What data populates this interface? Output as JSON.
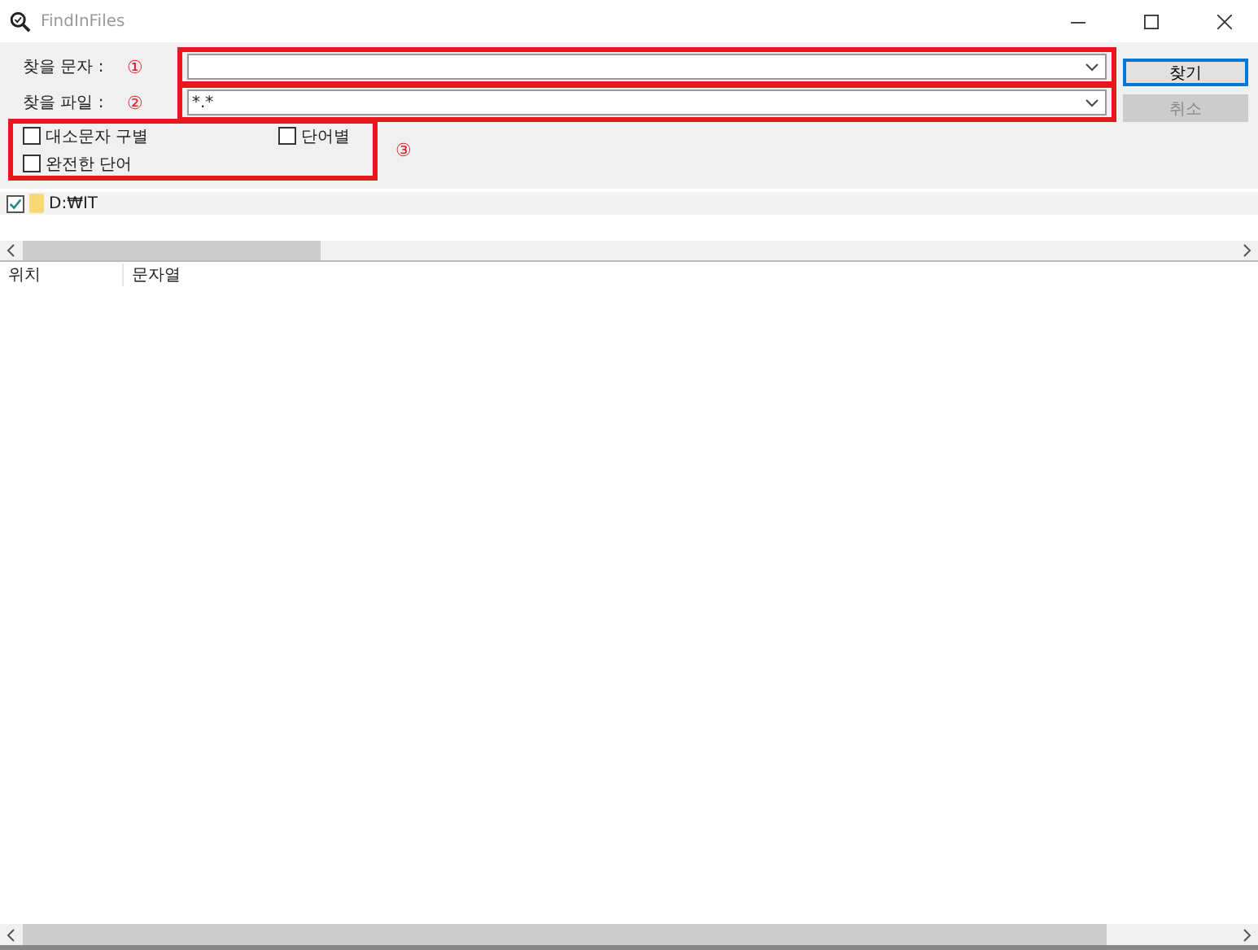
{
  "window": {
    "title": "FindInFiles"
  },
  "search_text": {
    "label": "찾을 문자 :",
    "marker": "①"
  },
  "file_pattern": {
    "label": "찾을 파일 :",
    "marker": "②",
    "value": "*.*"
  },
  "buttons": [
    {
      "label": "찾기",
      "disabled": false
    },
    {
      "label": "취소",
      "disabled": true
    }
  ],
  "options": {
    "marker": "③",
    "items": [
      {
        "label": "대소문자 구별",
        "checked": false
      },
      {
        "label": "단어별",
        "checked": false
      },
      {
        "label": "완전한 단어",
        "checked": false
      }
    ]
  },
  "tree": [
    {
      "label": "D:₩IT",
      "checked": true
    }
  ],
  "results": {
    "columns": [
      "위치",
      "문자열"
    ]
  }
}
